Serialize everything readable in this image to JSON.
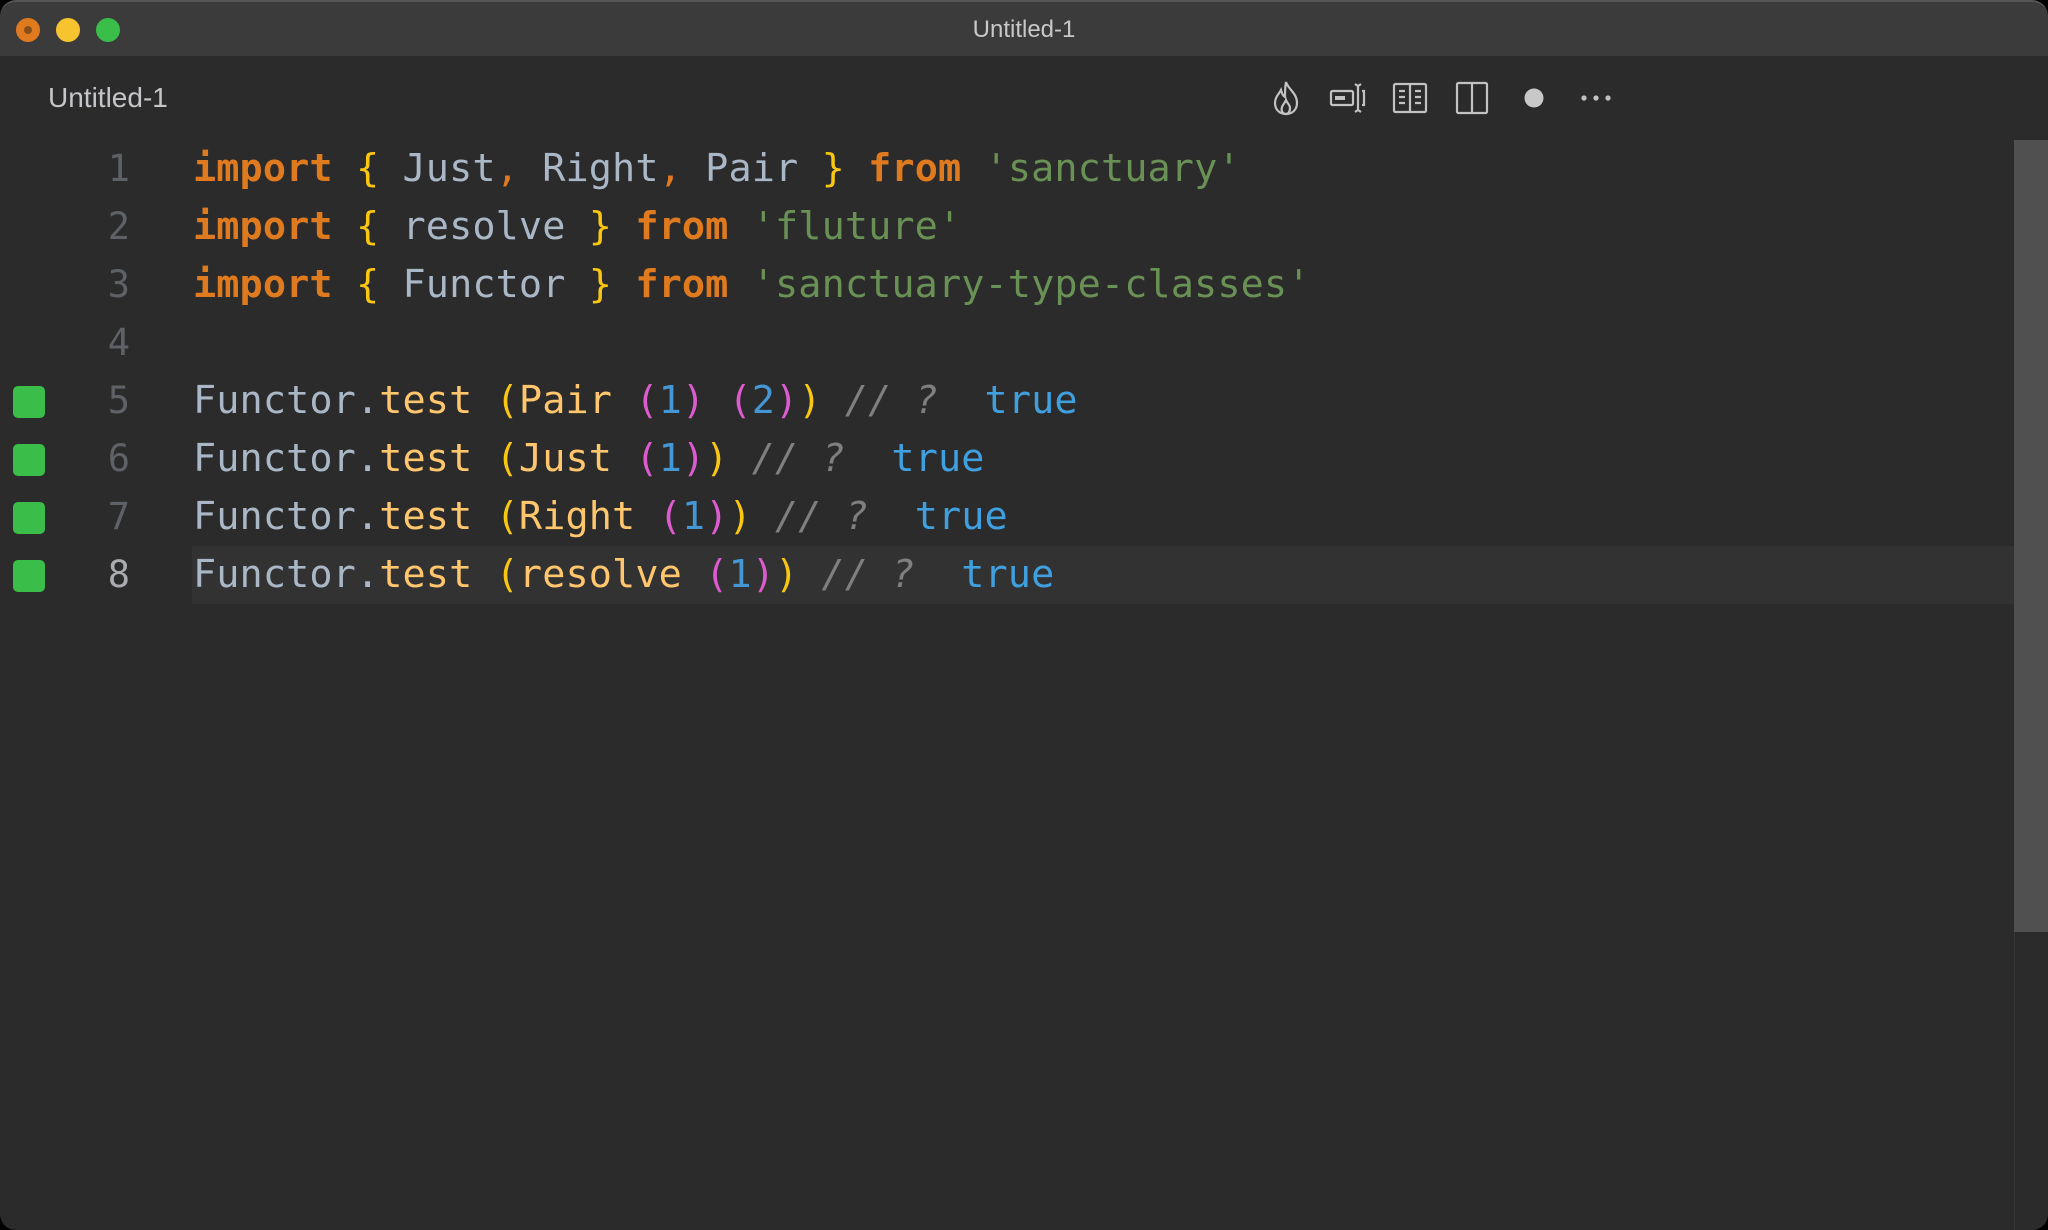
{
  "window": {
    "title": "Untitled-1",
    "controls": [
      "close",
      "minimize",
      "maximize"
    ]
  },
  "tab": {
    "label": "Untitled-1"
  },
  "toolbar": {
    "actions": [
      {
        "icon": "flame-icon",
        "label": "Run"
      },
      {
        "icon": "text-cursor-box-icon",
        "label": "Toggle Inline Values"
      },
      {
        "icon": "open-book-icon",
        "label": "Open Preview"
      },
      {
        "icon": "split-editor-icon",
        "label": "Split Editor"
      },
      {
        "icon": "unsaved-dot-icon",
        "label": "Unsaved changes"
      },
      {
        "icon": "more-icon",
        "label": "More Actions"
      }
    ]
  },
  "colors": {
    "keyword": "#e07a1f",
    "brace": "#f9c70f",
    "identifier": "#a9b7c6",
    "string": "#6a9155",
    "function": "#ffc66d",
    "nested_paren": "#dc5ccf",
    "number": "#4496d4",
    "comment": "#7f7f7f",
    "result": "#3f9fdf",
    "coverage_marker": "#3bbd4a"
  },
  "editor": {
    "active_line": 8,
    "lines": [
      {
        "number": "1",
        "marker": false,
        "tokens": [
          {
            "t": "import",
            "c": "kw"
          },
          {
            "t": " ",
            "c": "id"
          },
          {
            "t": "{",
            "c": "br"
          },
          {
            "t": " Just",
            "c": "id"
          },
          {
            "t": ",",
            "c": "pun"
          },
          {
            "t": " Right",
            "c": "id"
          },
          {
            "t": ",",
            "c": "pun"
          },
          {
            "t": " Pair ",
            "c": "id"
          },
          {
            "t": "}",
            "c": "br"
          },
          {
            "t": " ",
            "c": "id"
          },
          {
            "t": "from",
            "c": "kw"
          },
          {
            "t": " ",
            "c": "id"
          },
          {
            "t": "'sanctuary'",
            "c": "str"
          }
        ]
      },
      {
        "number": "2",
        "marker": false,
        "tokens": [
          {
            "t": "import",
            "c": "kw"
          },
          {
            "t": " ",
            "c": "id"
          },
          {
            "t": "{",
            "c": "br"
          },
          {
            "t": " resolve ",
            "c": "id"
          },
          {
            "t": "}",
            "c": "br"
          },
          {
            "t": " ",
            "c": "id"
          },
          {
            "t": "from",
            "c": "kw"
          },
          {
            "t": " ",
            "c": "id"
          },
          {
            "t": "'fluture'",
            "c": "str"
          }
        ]
      },
      {
        "number": "3",
        "marker": false,
        "tokens": [
          {
            "t": "import",
            "c": "kw"
          },
          {
            "t": " ",
            "c": "id"
          },
          {
            "t": "{",
            "c": "br"
          },
          {
            "t": " Functor ",
            "c": "id"
          },
          {
            "t": "}",
            "c": "br"
          },
          {
            "t": " ",
            "c": "id"
          },
          {
            "t": "from",
            "c": "kw"
          },
          {
            "t": " ",
            "c": "id"
          },
          {
            "t": "'sanctuary-type-classes'",
            "c": "str"
          }
        ]
      },
      {
        "number": "4",
        "marker": false,
        "tokens": []
      },
      {
        "number": "5",
        "marker": true,
        "tokens": [
          {
            "t": "Functor",
            "c": "id"
          },
          {
            "t": ".",
            "c": "id"
          },
          {
            "t": "test",
            "c": "fn"
          },
          {
            "t": " ",
            "c": "id"
          },
          {
            "t": "(",
            "c": "br"
          },
          {
            "t": "Pair",
            "c": "fn"
          },
          {
            "t": " ",
            "c": "id"
          },
          {
            "t": "(",
            "c": "p2"
          },
          {
            "t": "1",
            "c": "num"
          },
          {
            "t": ")",
            "c": "p2"
          },
          {
            "t": " ",
            "c": "id"
          },
          {
            "t": "(",
            "c": "p2"
          },
          {
            "t": "2",
            "c": "num"
          },
          {
            "t": ")",
            "c": "p2"
          },
          {
            "t": ")",
            "c": "br"
          },
          {
            "t": " // ?",
            "c": "cm"
          },
          {
            "t": "  ",
            "c": "id"
          },
          {
            "t": "true",
            "c": "val"
          }
        ]
      },
      {
        "number": "6",
        "marker": true,
        "tokens": [
          {
            "t": "Functor",
            "c": "id"
          },
          {
            "t": ".",
            "c": "id"
          },
          {
            "t": "test",
            "c": "fn"
          },
          {
            "t": " ",
            "c": "id"
          },
          {
            "t": "(",
            "c": "br"
          },
          {
            "t": "Just",
            "c": "fn"
          },
          {
            "t": " ",
            "c": "id"
          },
          {
            "t": "(",
            "c": "p2"
          },
          {
            "t": "1",
            "c": "num"
          },
          {
            "t": ")",
            "c": "p2"
          },
          {
            "t": ")",
            "c": "br"
          },
          {
            "t": " // ?",
            "c": "cm"
          },
          {
            "t": "  ",
            "c": "id"
          },
          {
            "t": "true",
            "c": "val"
          }
        ]
      },
      {
        "number": "7",
        "marker": true,
        "tokens": [
          {
            "t": "Functor",
            "c": "id"
          },
          {
            "t": ".",
            "c": "id"
          },
          {
            "t": "test",
            "c": "fn"
          },
          {
            "t": " ",
            "c": "id"
          },
          {
            "t": "(",
            "c": "br"
          },
          {
            "t": "Right",
            "c": "fn"
          },
          {
            "t": " ",
            "c": "id"
          },
          {
            "t": "(",
            "c": "p2"
          },
          {
            "t": "1",
            "c": "num"
          },
          {
            "t": ")",
            "c": "p2"
          },
          {
            "t": ")",
            "c": "br"
          },
          {
            "t": " // ?",
            "c": "cm"
          },
          {
            "t": "  ",
            "c": "id"
          },
          {
            "t": "true",
            "c": "val"
          }
        ]
      },
      {
        "number": "8",
        "marker": true,
        "tokens": [
          {
            "t": "Functor",
            "c": "id"
          },
          {
            "t": ".",
            "c": "id"
          },
          {
            "t": "test",
            "c": "fn"
          },
          {
            "t": " ",
            "c": "id"
          },
          {
            "t": "(",
            "c": "br"
          },
          {
            "t": "resolve",
            "c": "fn"
          },
          {
            "t": " ",
            "c": "id"
          },
          {
            "t": "(",
            "c": "p2"
          },
          {
            "t": "1",
            "c": "num"
          },
          {
            "t": ")",
            "c": "p2"
          },
          {
            "t": ")",
            "c": "br"
          },
          {
            "t": " // ?",
            "c": "cm"
          },
          {
            "t": "  ",
            "c": "id"
          },
          {
            "t": "true",
            "c": "val"
          }
        ]
      }
    ]
  }
}
